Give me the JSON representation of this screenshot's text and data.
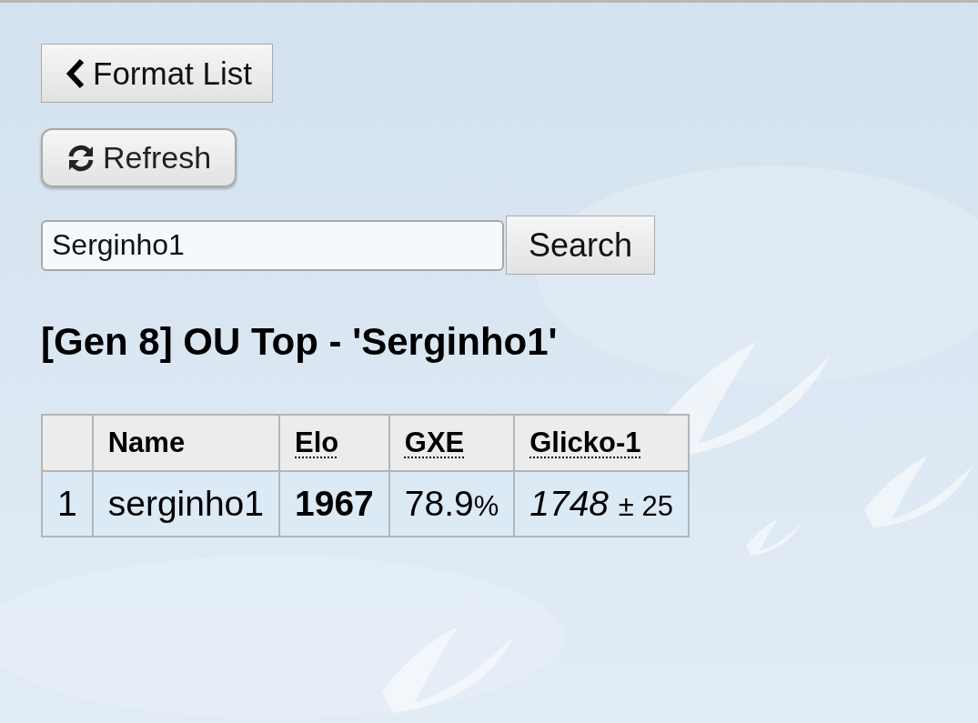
{
  "back_button": {
    "label": "Format List"
  },
  "refresh_button": {
    "label": "Refresh"
  },
  "search": {
    "value": "Serginho1",
    "button": "Search"
  },
  "heading": "[Gen 8] OU Top - 'Serginho1'",
  "table": {
    "columns": [
      {},
      {
        "label": "Name",
        "abbr": false
      },
      {
        "label": "Elo",
        "abbr": true
      },
      {
        "label": "GXE",
        "abbr": true
      },
      {
        "label": "Glicko-1",
        "abbr": true
      }
    ],
    "rows": [
      {
        "cells": [
          {
            "kind": "plain",
            "text": "1"
          },
          {
            "kind": "plain",
            "text": "serginho1"
          },
          {
            "kind": "bold",
            "text": "1967"
          },
          {
            "kind": "unit",
            "text": "78.9",
            "small": "%"
          },
          {
            "kind": "italic",
            "text": "1748",
            "small": "± 25"
          }
        ]
      }
    ]
  }
}
